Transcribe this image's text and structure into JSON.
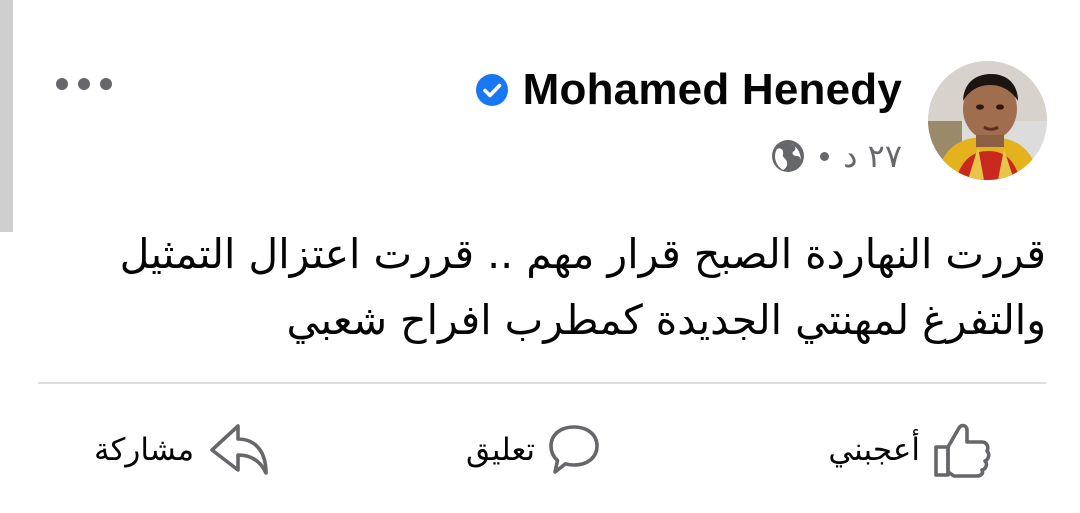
{
  "post": {
    "author": {
      "name": "Mohamed Henedy",
      "verified": true
    },
    "timestamp": "٢٧ د",
    "privacy_icon": "globe-icon",
    "text": "قررت النهاردة الصبح قرار مهم .. قررت اعتزال التمثيل والتفرغ لمهنتي الجديدة كمطرب افراح شعبي"
  },
  "actions": {
    "like_label": "أعجبني",
    "comment_label": "تعليق",
    "share_label": "مشاركة"
  },
  "icons": {
    "more": "more-horizontal-icon",
    "verified": "verified-badge-icon",
    "like": "thumbs-up-icon",
    "comment": "comment-bubble-icon",
    "share": "share-arrow-icon"
  },
  "colors": {
    "verified_blue": "#1877f2",
    "secondary_text": "#65676b",
    "divider": "#dcdde1"
  }
}
